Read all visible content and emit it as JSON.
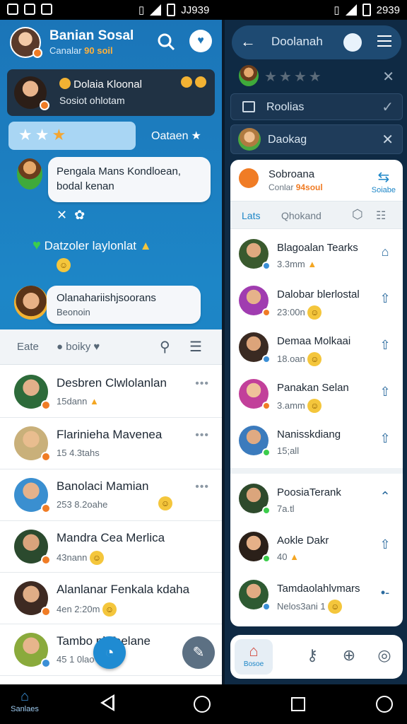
{
  "status_bar": {
    "left_time": "JJ939",
    "right_time": "2939"
  },
  "left_panel": {
    "header": {
      "title": "Banian Sosal",
      "subtitle_prefix": "Canalar",
      "subtitle_accent": "90 soil"
    },
    "featured_card": {
      "name": "Dolaia Kloonal",
      "sub": "Sosiot ohlotam"
    },
    "stars_label": "Oataen",
    "bubble_1": "Pengala Mans Kondloean, bodal kenan",
    "green_line": "Datzoler laylonlat",
    "bubble_2": {
      "title": "Olanahariishjsoorans",
      "sub": "Beonoin"
    },
    "list_toolbar": {
      "tab_1": "Eate",
      "tab_2": "boiky"
    },
    "chats": [
      {
        "name": "Desbren Clwlolanlan",
        "meta": "15dann",
        "avatar_color": "#2d6b3a"
      },
      {
        "name": "Flarinieha Mavenea",
        "meta": "15 4.3tahs",
        "avatar_color": "#c9b07a"
      },
      {
        "name": "Banolaci Mamian",
        "meta": "253 8.2oahe",
        "avatar_color": "#3a8fd0"
      },
      {
        "name": "Mandra Cea Merlica",
        "meta": "43nann",
        "avatar_color": "#2b4a2e"
      },
      {
        "name": "Alanlanar Fenkala kdaha",
        "meta": "4en 2:20m",
        "avatar_color": "#3e2a22"
      },
      {
        "name": "Tambo  nl Taelane",
        "meta": "45 1 0lao",
        "avatar_color": "#8aaa3c"
      }
    ]
  },
  "right_panel": {
    "header": {
      "title": "Doolanah"
    },
    "row_box": "Roolias",
    "row_box2": "Daokag",
    "card": {
      "title": "Sobroana",
      "sub_prefix": "Conlar",
      "sub_accent": "94soul",
      "action": "Soiabe",
      "tab_1": "Lats",
      "tab_2": "Qhokand",
      "contacts": [
        {
          "name": "Blagoalan Tearks",
          "meta": "3.3mm",
          "avatar_color": "#3a5a2e"
        },
        {
          "name": "Dalobar blerlostal",
          "meta": "23:00n",
          "avatar_color": "#a03cb0"
        },
        {
          "name": "Demaa Molkaai",
          "meta": "18.oan",
          "avatar_color": "#3a2a22"
        },
        {
          "name": "Panakan Selan",
          "meta": "3.amm",
          "avatar_color": "#c2409a"
        },
        {
          "name": "Nanisskdiang",
          "meta": "15;all",
          "avatar_color": "#3b7bbd"
        },
        {
          "name": "PoosiaTerank",
          "meta": "7a.tl",
          "avatar_color": "#2e4a2c"
        },
        {
          "name": "Aokle Dakr",
          "meta": "40",
          "avatar_color": "#2b2019"
        },
        {
          "name": "Tamdaolahlvmars",
          "meta": "Nelos3ani 1",
          "avatar_color": "#2e5a32"
        }
      ]
    },
    "bottom_home_label": "Bosoe"
  },
  "nav": {
    "home_label": "Sanlaes"
  },
  "colors": {
    "accent": "#1d86c7",
    "badge": "#f07c25",
    "right_bg": "#0f2a44"
  }
}
